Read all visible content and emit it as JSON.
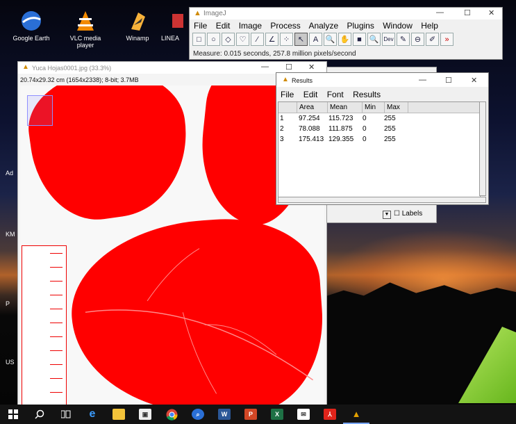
{
  "desktop": {
    "icons": [
      {
        "label": "Google Earth",
        "icon": "google-earth-icon"
      },
      {
        "label": "VLC media player",
        "icon": "vlc-icon"
      },
      {
        "label": "Winamp",
        "icon": "winamp-icon"
      },
      {
        "label": "LINEA",
        "icon": "shortcut-icon"
      }
    ],
    "edge_labels": [
      "Ad",
      "KM",
      "P",
      "US"
    ]
  },
  "imagej": {
    "title": "ImageJ",
    "menu": [
      "File",
      "Edit",
      "Image",
      "Process",
      "Analyze",
      "Plugins",
      "Window",
      "Help"
    ],
    "tools": [
      "□",
      "○",
      "◇",
      "♡",
      "∕",
      "∠",
      "⁘",
      "↖",
      "A",
      "🔍",
      "✋",
      "■",
      "🔍",
      "Dev",
      "✎",
      "⊖",
      "✐",
      "»"
    ],
    "status": "Measure: 0.015 seconds, 257.8 million pixels/second"
  },
  "image_window": {
    "title": "Yuca Hojas0001.jpg (33.3%)",
    "info": "20.74x29.32 cm (1654x2338); 8-bit; 3.7MB"
  },
  "results": {
    "title": "Results",
    "menu": [
      "File",
      "Edit",
      "Font",
      "Results"
    ],
    "columns": [
      "",
      "Area",
      "Mean",
      "Min",
      "Max"
    ],
    "rows": [
      [
        "1",
        "97.254",
        "115.723",
        "0",
        "255"
      ],
      [
        "2",
        "78.088",
        "111.875",
        "0",
        "255"
      ],
      [
        "3",
        "175.413",
        "129.355",
        "0",
        "255"
      ]
    ]
  },
  "behind_window": {
    "checkbox_label": "Labels"
  },
  "taskbar": {
    "items": [
      "windows-start-icon",
      "search-icon",
      "task-view-icon",
      "edge-icon",
      "file-explorer-icon",
      "store-icon",
      "chrome-icon",
      "zoom-search-icon",
      "word-icon",
      "powerpoint-icon",
      "excel-icon",
      "mail-icon",
      "pdf-icon",
      "imagej-icon"
    ]
  },
  "colors": {
    "leaf": "#ff0000",
    "taskbar": "#131313"
  }
}
